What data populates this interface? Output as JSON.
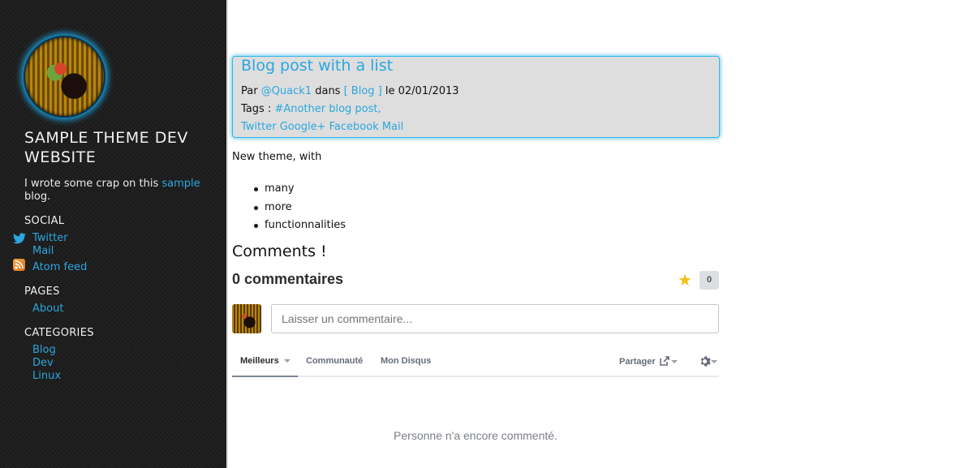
{
  "sidebar": {
    "title": "SAMPLE THEME DEV WEBSITE",
    "desc_before": "I wrote some crap on this ",
    "desc_link": "sample",
    "desc_after": " blog.",
    "social_heading": "SOCIAL",
    "social": [
      {
        "label": "Twitter",
        "icon": "twitter-icon"
      },
      {
        "label": "Mail"
      },
      {
        "label": "Atom feed",
        "icon": "rss-icon"
      }
    ],
    "pages_heading": "PAGES",
    "pages": [
      {
        "label": "About"
      }
    ],
    "categories_heading": "CATEGORIES",
    "categories": [
      {
        "label": "Blog"
      },
      {
        "label": "Dev"
      },
      {
        "label": "Linux"
      }
    ]
  },
  "post": {
    "title": "Blog post with a list",
    "by_label": "Par ",
    "author": "@Quack1",
    "in_label": " dans ",
    "category": "[ Blog ]",
    "date_label": " le 02/01/2013",
    "tags_label": "Tags : ",
    "tag": "#Another blog post,",
    "share": [
      "Twitter",
      "Google+",
      "Facebook",
      "Mail"
    ],
    "intro": "New theme, with",
    "list": [
      "many",
      "more",
      "functionnalities"
    ],
    "comments_heading": "Comments !"
  },
  "disqus": {
    "count_label": "0 commentaires",
    "star_count": "0",
    "input_placeholder": "Laisser un commentaire...",
    "tabs": [
      "Meilleurs",
      "Communauté",
      "Mon Disqus"
    ],
    "share_label": "Partager",
    "empty_text": "Personne n'a encore commenté.",
    "colors": {
      "star": "#f5c018",
      "link": "#2ba6de"
    }
  }
}
